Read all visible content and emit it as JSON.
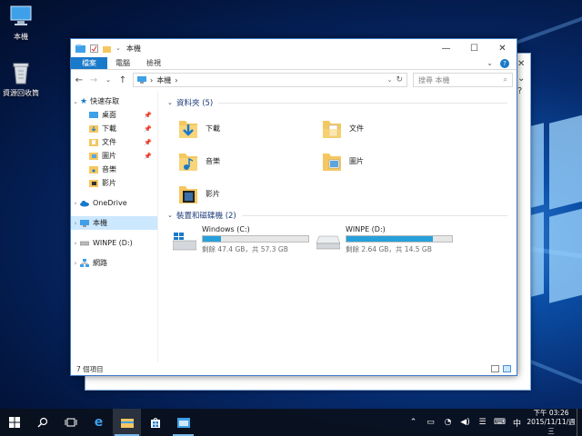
{
  "desktop": {
    "icons": [
      {
        "label": "本機",
        "icon": "computer-icon"
      },
      {
        "label": "資源回收筒",
        "icon": "recycle-bin-icon"
      }
    ]
  },
  "window": {
    "title": "本機",
    "controls": {
      "minimize": "—",
      "maximize": "☐",
      "close": "✕"
    },
    "ribbon_tabs": [
      "檔案",
      "電腦",
      "檢視"
    ],
    "ribbon_expand": "⌄",
    "help": "?",
    "nav_back": "←",
    "nav_forward": "→",
    "nav_recent": "⌄",
    "nav_up": "↑",
    "address": {
      "sep": "›",
      "location": "本機",
      "tail": "›",
      "dropdown": "⌄",
      "refresh": "↻"
    },
    "search": {
      "placeholder": "搜尋 本機",
      "icon": "⌕"
    },
    "sidebar": {
      "quick_access": "快速存取",
      "quick_items": [
        "桌面",
        "下載",
        "文件",
        "圖片",
        "音樂",
        "影片"
      ],
      "onedrive": "OneDrive",
      "this_pc": "本機",
      "winpe": "WINPE (D:)",
      "network": "網路"
    },
    "folders_group": "資料夾 (5)",
    "folders": [
      {
        "name": "下載",
        "icon": "downloads-folder-icon"
      },
      {
        "name": "文件",
        "icon": "documents-folder-icon"
      },
      {
        "name": "音樂",
        "icon": "music-folder-icon"
      },
      {
        "name": "圖片",
        "icon": "pictures-folder-icon"
      },
      {
        "name": "影片",
        "icon": "videos-folder-icon"
      }
    ],
    "drives_group": "裝置和磁碟機 (2)",
    "drives": [
      {
        "name": "Windows (C:)",
        "free": "剩餘 47.4 GB，共 57.3 GB",
        "used_fraction": 0.17
      },
      {
        "name": "WINPE (D:)",
        "free": "剩餘 2.64 GB，共 14.5 GB",
        "used_fraction": 0.82
      }
    ],
    "status": "7 個項目"
  },
  "taskbar": {
    "clock_time": "下午 03:26",
    "clock_date": "2015/11/11/週三",
    "ime": "中",
    "accent": "#76b9ed"
  },
  "colors": {
    "ribbon_file_tab": "#1979ca",
    "selection": "#cce8ff",
    "drive_bar": "#26a0da",
    "folder": "#f5c760"
  }
}
